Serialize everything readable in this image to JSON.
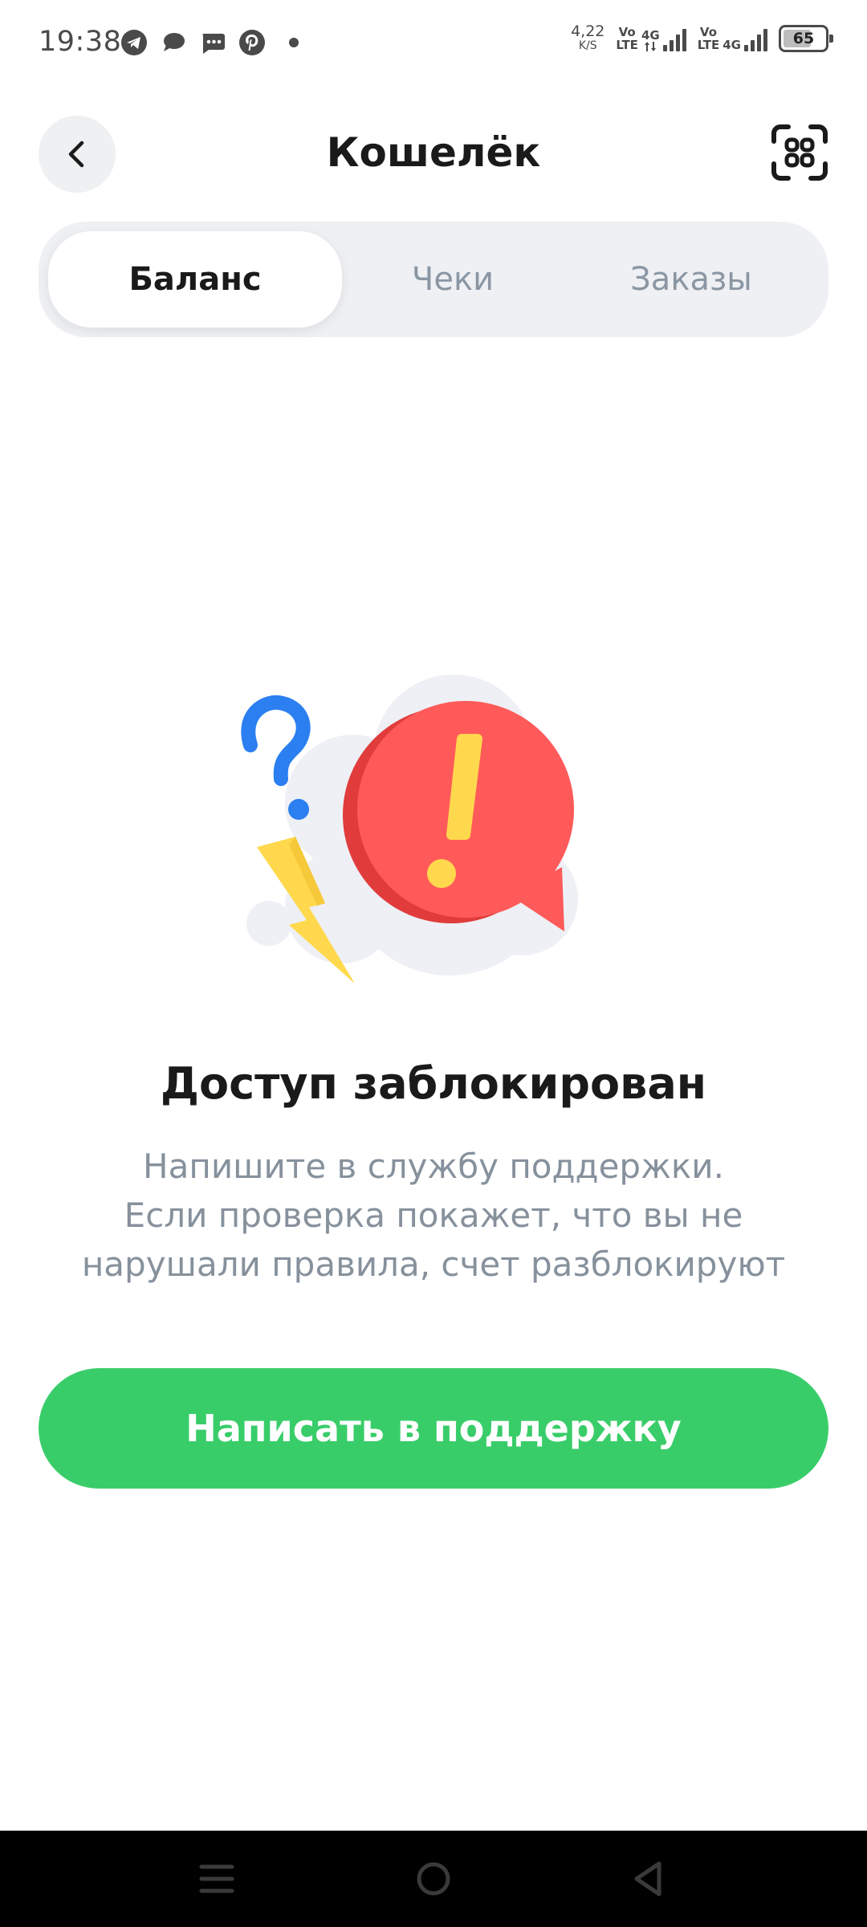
{
  "status_bar": {
    "time": "19:38",
    "notification_icons": [
      "telegram-icon",
      "chat-bubble-icon",
      "messages-icon",
      "pinterest-icon"
    ],
    "net_speed": "4,22",
    "net_speed_unit": "K/S",
    "sim1": {
      "top": "Vo",
      "bottom": "LTE",
      "type": "4G"
    },
    "sim2": {
      "top": "Vo",
      "bottom": "LTE",
      "type": "4G"
    },
    "battery": "65"
  },
  "header": {
    "title": "Кошелёк",
    "back_icon": "chevron-left-icon",
    "scan_icon": "qr-scan-icon"
  },
  "tabs": [
    {
      "label": "Баланс",
      "active": true
    },
    {
      "label": "Чеки",
      "active": false
    },
    {
      "label": "Заказы",
      "active": false
    }
  ],
  "message": {
    "title": "Доступ заблокирован",
    "line1": "Напишите в службу поддержки.",
    "line2": "Если проверка покажет, что вы не",
    "line3": "нарушали правила, счет разблокируют"
  },
  "support_button": {
    "label": "Написать в поддержку"
  },
  "colors": {
    "accent_green": "#39cd6a",
    "alert_red": "#ff5a5a",
    "warning_yellow": "#ffd84d",
    "question_blue": "#2b7ff0",
    "muted_text": "#86919c"
  },
  "nav_bar": {
    "icons": [
      "menu-icon",
      "home-icon",
      "back-triangle-icon"
    ]
  }
}
